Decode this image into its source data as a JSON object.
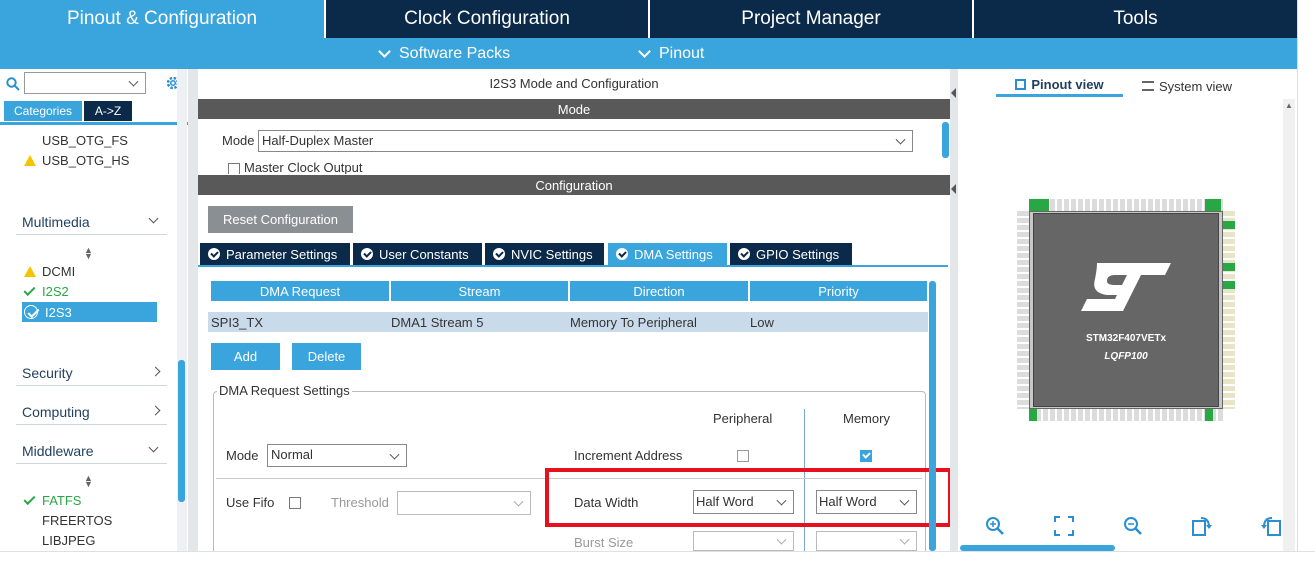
{
  "top_tabs": [
    "Pinout & Configuration",
    "Clock Configuration",
    "Project Manager",
    "Tools"
  ],
  "sub_menu": [
    "Software Packs",
    "Pinout"
  ],
  "left": {
    "search_value": "",
    "tab_categories": "Categories",
    "tab_az": "A->Z",
    "usb_items": [
      "USB_OTG_FS",
      "USB_OTG_HS"
    ],
    "multimedia_label": "Multimedia",
    "multimedia_items": [
      "DCMI",
      "I2S2",
      "I2S3"
    ],
    "security_label": "Security",
    "computing_label": "Computing",
    "middleware_label": "Middleware",
    "middleware_items": [
      "FATFS",
      "FREERTOS",
      "LIBJPEG"
    ]
  },
  "center": {
    "title": "I2S3 Mode and Configuration",
    "mode_header": "Mode",
    "mode_label": "Mode",
    "mode_value": "Half-Duplex Master",
    "mclk_label": "Master Clock Output",
    "config_header": "Configuration",
    "reset_button": "Reset Configuration",
    "tabs": [
      "Parameter Settings",
      "User Constants",
      "NVIC Settings",
      "DMA Settings",
      "GPIO Settings"
    ],
    "table": {
      "columns": [
        "DMA Request",
        "Stream",
        "Direction",
        "Priority"
      ],
      "rows": [
        [
          "SPI3_TX",
          "DMA1 Stream 5",
          "Memory To Peripheral",
          "Low"
        ]
      ]
    },
    "add_button": "Add",
    "delete_button": "Delete",
    "group_title": "DMA Request Settings",
    "peripheral_label": "Peripheral",
    "memory_label": "Memory",
    "dma_mode_label": "Mode",
    "dma_mode_value": "Normal",
    "increment_label": "Increment Address",
    "peripheral_increment": false,
    "memory_increment": true,
    "fifo_label": "Use Fifo",
    "threshold_label": "Threshold",
    "data_width_label": "Data Width",
    "peripheral_width": "Half Word",
    "memory_width": "Half Word",
    "burst_label": "Burst Size",
    "highlight_color": "#e8101e"
  },
  "right": {
    "pinout_view": "Pinout view",
    "system_view": "System view",
    "chip_name": "STM32F407VETx",
    "package": "LQFP100"
  }
}
